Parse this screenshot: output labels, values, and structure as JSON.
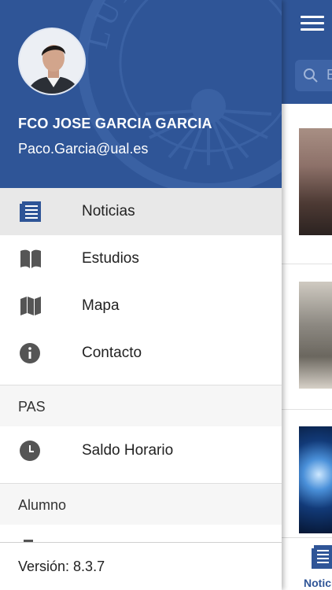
{
  "colors": {
    "brand": "#2f5597",
    "active_row": "#e8e8e8",
    "icon_gray": "#555555"
  },
  "background": {
    "search_placeholder_fragment": "E",
    "tab_label_fragment": "Notici"
  },
  "profile": {
    "name": "FCO JOSE GARCIA GARCIA",
    "email": "Paco.Garcia@ual.es",
    "seal_text": "LUMINE SAP"
  },
  "menu": {
    "items": [
      {
        "label": "Noticias",
        "icon": "newspaper-icon"
      },
      {
        "label": "Estudios",
        "icon": "book-icon"
      },
      {
        "label": "Mapa",
        "icon": "map-icon"
      },
      {
        "label": "Contacto",
        "icon": "info-icon"
      }
    ],
    "sections": [
      {
        "title": "PAS",
        "items": [
          {
            "label": "Saldo Horario",
            "icon": "clock-icon"
          }
        ]
      },
      {
        "title": "Alumno",
        "items": []
      }
    ]
  },
  "footer": {
    "version": "Versión: 8.3.7"
  }
}
